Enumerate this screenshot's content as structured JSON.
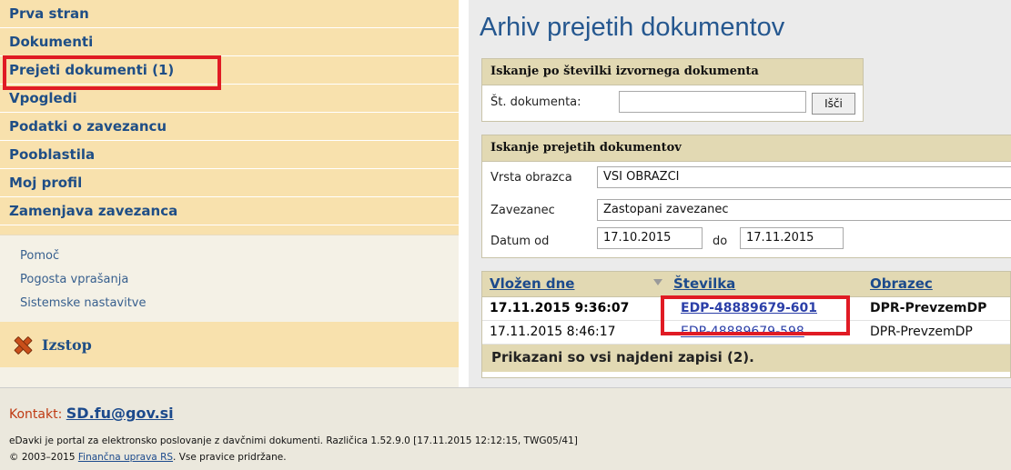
{
  "nav": {
    "items": [
      {
        "label": "Prva stran"
      },
      {
        "label": "Dokumenti"
      },
      {
        "label": "Prejeti dokumenti (1)"
      },
      {
        "label": "Vpogledi"
      },
      {
        "label": "Podatki o zavezancu"
      },
      {
        "label": "Pooblastila"
      },
      {
        "label": "Moj profil"
      },
      {
        "label": "Zamenjava zavezanca"
      }
    ],
    "links": [
      {
        "label": "Pomoč"
      },
      {
        "label": "Pogosta vprašanja"
      },
      {
        "label": "Sistemske nastavitve"
      }
    ],
    "exit_label": "Izstop"
  },
  "main": {
    "title": "Arhiv prejetih dokumentov",
    "search_by_number": {
      "heading": "Iskanje po številki izvornega dokumenta",
      "label": "Št. dokumenta:",
      "value": "",
      "button": "Išči"
    },
    "search_received": {
      "heading": "Iskanje prejetih dokumentov",
      "form_type_label": "Vrsta obrazca",
      "form_type_value": "VSI OBRAZCI",
      "taxpayer_label": "Zavezanec",
      "taxpayer_value": "Zastopani zavezanec",
      "date_from_label": "Datum od",
      "date_from_value": "17.10.2015",
      "date_to_label": "do",
      "date_to_value": "17.11.2015"
    },
    "results": {
      "columns": [
        "Vložen dne",
        "Številka",
        "Obrazec"
      ],
      "rows": [
        {
          "date": "17.11.2015 9:36:07",
          "number": "EDP-48889679-601",
          "form": "DPR-PrevzemDP"
        },
        {
          "date": "17.11.2015 8:46:17",
          "number": "EDP-48889679-598",
          "form": "DPR-PrevzemDP"
        }
      ],
      "footer": "Prikazani so vsi najdeni zapisi (2)."
    }
  },
  "footer": {
    "contact_label": "Kontakt:",
    "contact_email": "SD.fu@gov.si",
    "line1": "eDavki je portal za elektronsko poslovanje z davčnimi dokumenti. Različica 1.52.9.0 [17.11.2015 12:12:15, TWG05/41]",
    "copyright_prefix": "© 2003–2015",
    "copyright_link": "Finančna uprava RS",
    "copyright_suffix": ". Vse pravice pridržane."
  },
  "colors": {
    "nav_bg": "#f8e1ad",
    "nav_text": "#1f4e86",
    "panel_head": "#e2d9b3",
    "highlight": "#e01b24",
    "title": "#25578f"
  }
}
